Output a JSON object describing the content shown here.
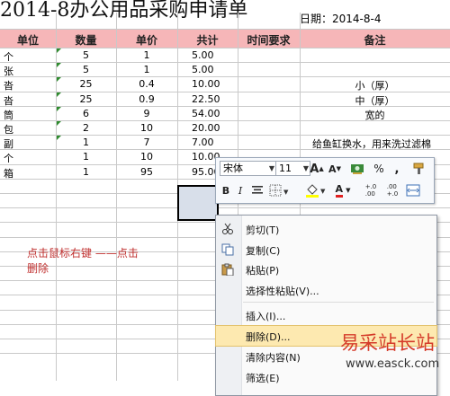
{
  "title": "2014-8办公用品采购申请单",
  "date": "日期：2014-8-4",
  "headers": [
    "单位",
    "数量",
    "单价",
    "共计",
    "时间要求",
    "备注"
  ],
  "rows": [
    [
      "个",
      "5",
      "1",
      "5.00",
      "",
      ""
    ],
    [
      "张",
      "5",
      "1",
      "5.00",
      "",
      ""
    ],
    [
      "沓",
      "25",
      "0.4",
      "10.00",
      "",
      "小（厚）"
    ],
    [
      "沓",
      "25",
      "0.9",
      "22.50",
      "",
      "中（厚）"
    ],
    [
      "筒",
      "6",
      "9",
      "54.00",
      "",
      "宽的"
    ],
    [
      "包",
      "2",
      "10",
      "20.00",
      "",
      ""
    ],
    [
      "副",
      "1",
      "7",
      "7.00",
      "",
      "给鱼缸换水，用来洗过滤棉"
    ],
    [
      "个",
      "1",
      "10",
      "10.00",
      "",
      ""
    ],
    [
      "箱",
      "1",
      "95",
      "95.00",
      "",
      ""
    ]
  ],
  "instruction": [
    "点击鼠标右键 ——点击",
    "删除"
  ],
  "mini_toolbar": {
    "font_name": "宋体",
    "font_size": "11",
    "grow_font": "A",
    "shrink_font": "A",
    "percent": "%",
    "comma": ",",
    "bold": "B",
    "italic": "I",
    "font_color": "A",
    "inc_decimal": "+.0\n.00",
    "dec_decimal": ".00\n+.0"
  },
  "context_menu": [
    {
      "label": "剪切(T)",
      "icon": "scissors-icon"
    },
    {
      "label": "复制(C)",
      "icon": "copy-icon"
    },
    {
      "label": "粘贴(P)",
      "icon": "paste-icon"
    },
    {
      "label": "选择性粘贴(V)...",
      "icon": ""
    },
    {
      "label": "插入(I)...",
      "icon": ""
    },
    {
      "label": "删除(D)...",
      "icon": ""
    },
    {
      "label": "清除内容(N)",
      "icon": ""
    },
    {
      "label": "筛选(E)",
      "icon": ""
    }
  ],
  "watermark": {
    "brand": "易采站长站",
    "url": "www.easck.com"
  }
}
